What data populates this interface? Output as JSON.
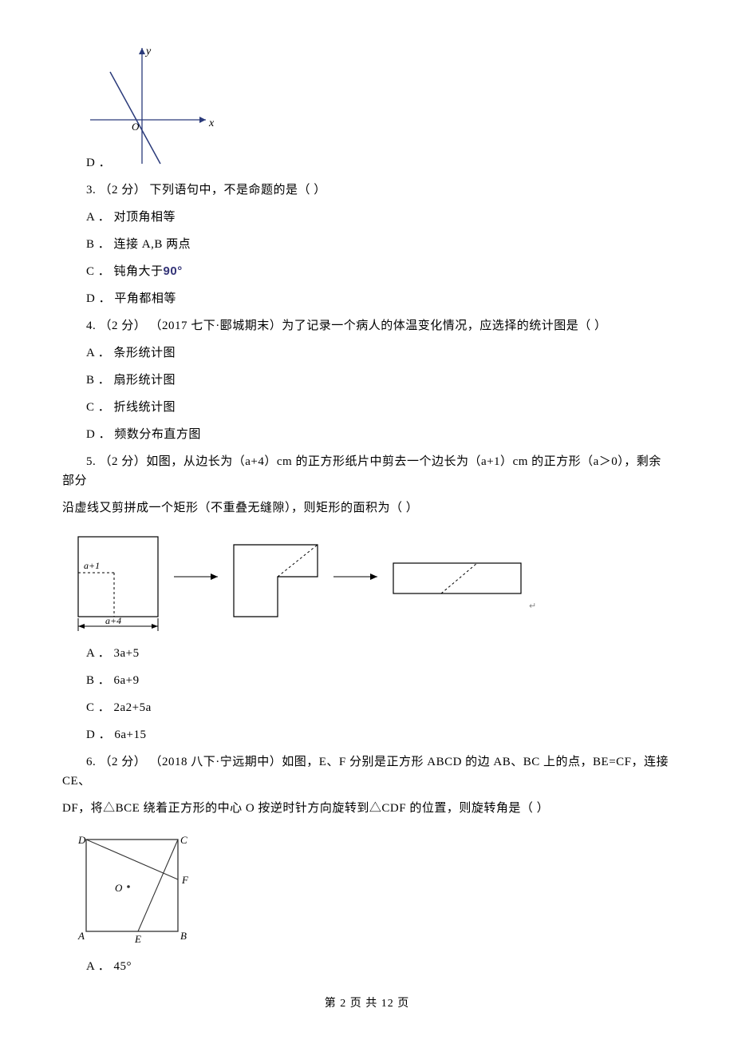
{
  "q2d_label": "D ．",
  "q2d_graph": {
    "x_label": "x",
    "y_label": "y",
    "origin_label": "O"
  },
  "q3": {
    "stem": "3.  （2 分）  下列语句中，不是命题的是（      ）",
    "a": "A ． 对顶角相等",
    "b": "B ． 连接 A,B 两点",
    "c_prefix": "C ． 钝角大于",
    "c_deg": "90°",
    "d": "D ． 平角都相等"
  },
  "q4": {
    "stem": "4.  （2 分） （2017 七下·郾城期末）为了记录一个病人的体温变化情况，应选择的统计图是（      ）",
    "a": "A ． 条形统计图",
    "b": "B ． 扇形统计图",
    "c": "C ． 折线统计图",
    "d": "D ． 频数分布直方图"
  },
  "q5": {
    "stem1": "5. （2 分）如图，从边长为（a+4）cm 的正方形纸片中剪去一个边长为（a+1）cm 的正方形（a＞0），剩余部分",
    "stem2": "沿虚线又剪拼成一个矩形（不重叠无缝隙），则矩形的面积为（      ）",
    "fig": {
      "label_top": "a+1",
      "label_bottom": "a+4"
    },
    "a": "A ． 3a+5",
    "b": "B ． 6a+9",
    "c": "C ． 2a2+5a",
    "d": "D ． 6a+15"
  },
  "q6": {
    "stem1": "6.  （2 分） （2018 八下·宁远期中）如图，E、F 分别是正方形 ABCD 的边 AB、BC 上的点，BE=CF，连接 CE、",
    "stem2": "DF，将△BCE 绕着正方形的中心 O 按逆时针方向旋转到△CDF 的位置，则旋转角是（      ）",
    "fig": {
      "A": "A",
      "B": "B",
      "C": "C",
      "D": "D",
      "E": "E",
      "F": "F",
      "O": "O"
    },
    "a": "A ． 45°"
  },
  "footer": "第 2 页 共 12 页"
}
